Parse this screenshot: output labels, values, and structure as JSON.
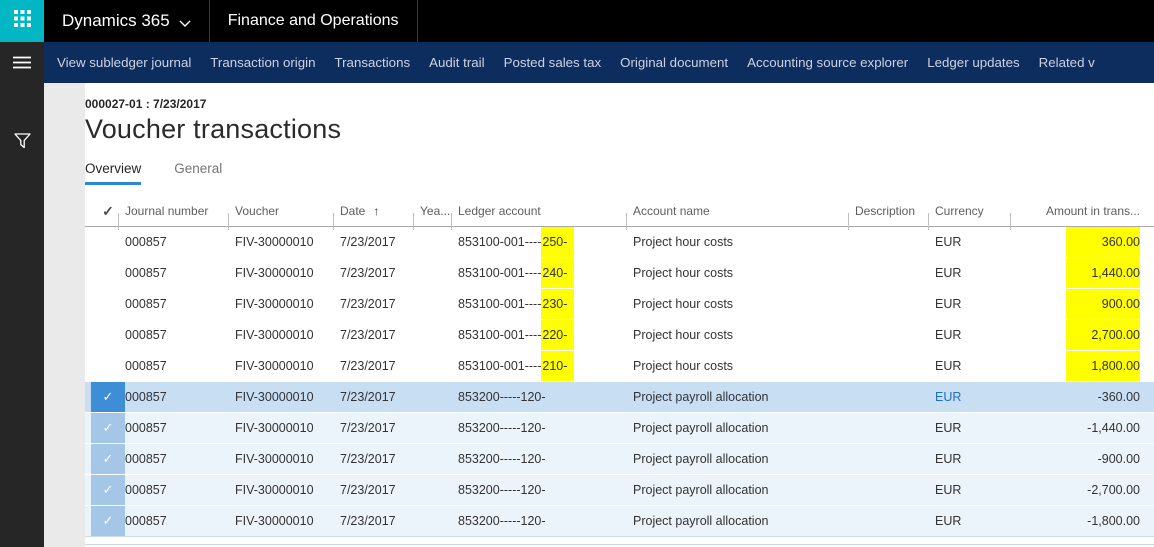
{
  "topbar": {
    "product": "Dynamics 365",
    "app": "Finance and Operations"
  },
  "icons": {
    "waffle": "app-launcher-grid",
    "chevron_down": "chevron-down",
    "hamburger": "hamburger-menu",
    "filter": "filter-funnel",
    "sort_asc": "↑",
    "check": "✓"
  },
  "action_bar": {
    "items": [
      "View subledger journal",
      "Transaction origin",
      "Transactions",
      "Audit trail",
      "Posted sales tax",
      "Original document",
      "Accounting source explorer",
      "Ledger updates",
      "Related v"
    ]
  },
  "page": {
    "record_id": "000027-01 : 7/23/2017",
    "title": "Voucher transactions"
  },
  "tabs": [
    {
      "label": "Overview",
      "active": true
    },
    {
      "label": "General",
      "active": false
    }
  ],
  "grid": {
    "columns": {
      "check": "",
      "journal": "Journal number",
      "voucher": "Voucher",
      "date": "Date",
      "year": "Yea...",
      "ledger": "Ledger account",
      "account": "Account name",
      "description": "Description",
      "currency": "Currency",
      "amount": "Amount in trans..."
    },
    "sort": {
      "column": "Date",
      "direction": "ascending"
    },
    "rows": [
      {
        "journal": "000857",
        "voucher": "FIV-30000010",
        "date": "7/23/2017",
        "year": "",
        "ledger_prefix": "853100-001----",
        "ledger_highlight": "250-",
        "account": "Project hour costs",
        "description": "",
        "currency": "EUR",
        "amount": "360.00",
        "highlighted": true,
        "selected": false,
        "current": false
      },
      {
        "journal": "000857",
        "voucher": "FIV-30000010",
        "date": "7/23/2017",
        "year": "",
        "ledger_prefix": "853100-001----",
        "ledger_highlight": "240-",
        "account": "Project hour costs",
        "description": "",
        "currency": "EUR",
        "amount": "1,440.00",
        "highlighted": true,
        "selected": false,
        "current": false
      },
      {
        "journal": "000857",
        "voucher": "FIV-30000010",
        "date": "7/23/2017",
        "year": "",
        "ledger_prefix": "853100-001----",
        "ledger_highlight": "230-",
        "account": "Project hour costs",
        "description": "",
        "currency": "EUR",
        "amount": "900.00",
        "highlighted": true,
        "selected": false,
        "current": false
      },
      {
        "journal": "000857",
        "voucher": "FIV-30000010",
        "date": "7/23/2017",
        "year": "",
        "ledger_prefix": "853100-001----",
        "ledger_highlight": "220-",
        "account": "Project hour costs",
        "description": "",
        "currency": "EUR",
        "amount": "2,700.00",
        "highlighted": true,
        "selected": false,
        "current": false
      },
      {
        "journal": "000857",
        "voucher": "FIV-30000010",
        "date": "7/23/2017",
        "year": "",
        "ledger_prefix": "853100-001----",
        "ledger_highlight": "210-",
        "account": "Project hour costs",
        "description": "",
        "currency": "EUR",
        "amount": "1,800.00",
        "highlighted": true,
        "selected": false,
        "current": false
      },
      {
        "journal": "000857",
        "voucher": "FIV-30000010",
        "date": "7/23/2017",
        "year": "",
        "ledger_prefix": "853200-----120-",
        "ledger_highlight": "",
        "account": "Project payroll allocation",
        "description": "",
        "currency": "EUR",
        "amount": "-360.00",
        "highlighted": false,
        "selected": true,
        "current": true
      },
      {
        "journal": "000857",
        "voucher": "FIV-30000010",
        "date": "7/23/2017",
        "year": "",
        "ledger_prefix": "853200-----120-",
        "ledger_highlight": "",
        "account": "Project payroll allocation",
        "description": "",
        "currency": "EUR",
        "amount": "-1,440.00",
        "highlighted": false,
        "selected": true,
        "current": false
      },
      {
        "journal": "000857",
        "voucher": "FIV-30000010",
        "date": "7/23/2017",
        "year": "",
        "ledger_prefix": "853200-----120-",
        "ledger_highlight": "",
        "account": "Project payroll allocation",
        "description": "",
        "currency": "EUR",
        "amount": "-900.00",
        "highlighted": false,
        "selected": true,
        "current": false
      },
      {
        "journal": "000857",
        "voucher": "FIV-30000010",
        "date": "7/23/2017",
        "year": "",
        "ledger_prefix": "853200-----120-",
        "ledger_highlight": "",
        "account": "Project payroll allocation",
        "description": "",
        "currency": "EUR",
        "amount": "-2,700.00",
        "highlighted": false,
        "selected": true,
        "current": false
      },
      {
        "journal": "000857",
        "voucher": "FIV-30000010",
        "date": "7/23/2017",
        "year": "",
        "ledger_prefix": "853200-----120-",
        "ledger_highlight": "",
        "account": "Project payroll allocation",
        "description": "",
        "currency": "EUR",
        "amount": "-1,800.00",
        "highlighted": false,
        "selected": true,
        "current": false
      }
    ]
  },
  "colors": {
    "teal_tile": "#00B7C3",
    "topbar": "#000000",
    "actionbar": "#0D2D5E",
    "sidenav": "#262626",
    "highlight_yellow": "#FFFF00",
    "current_row_bg": "#C7DEF3",
    "selected_row_bg": "#EBF3FB",
    "current_check_bg": "#3E8ED7",
    "selected_check_bg": "#A5C7E7",
    "tab_underline": "#2B88D8",
    "currency_link": "#1F6FC0"
  }
}
